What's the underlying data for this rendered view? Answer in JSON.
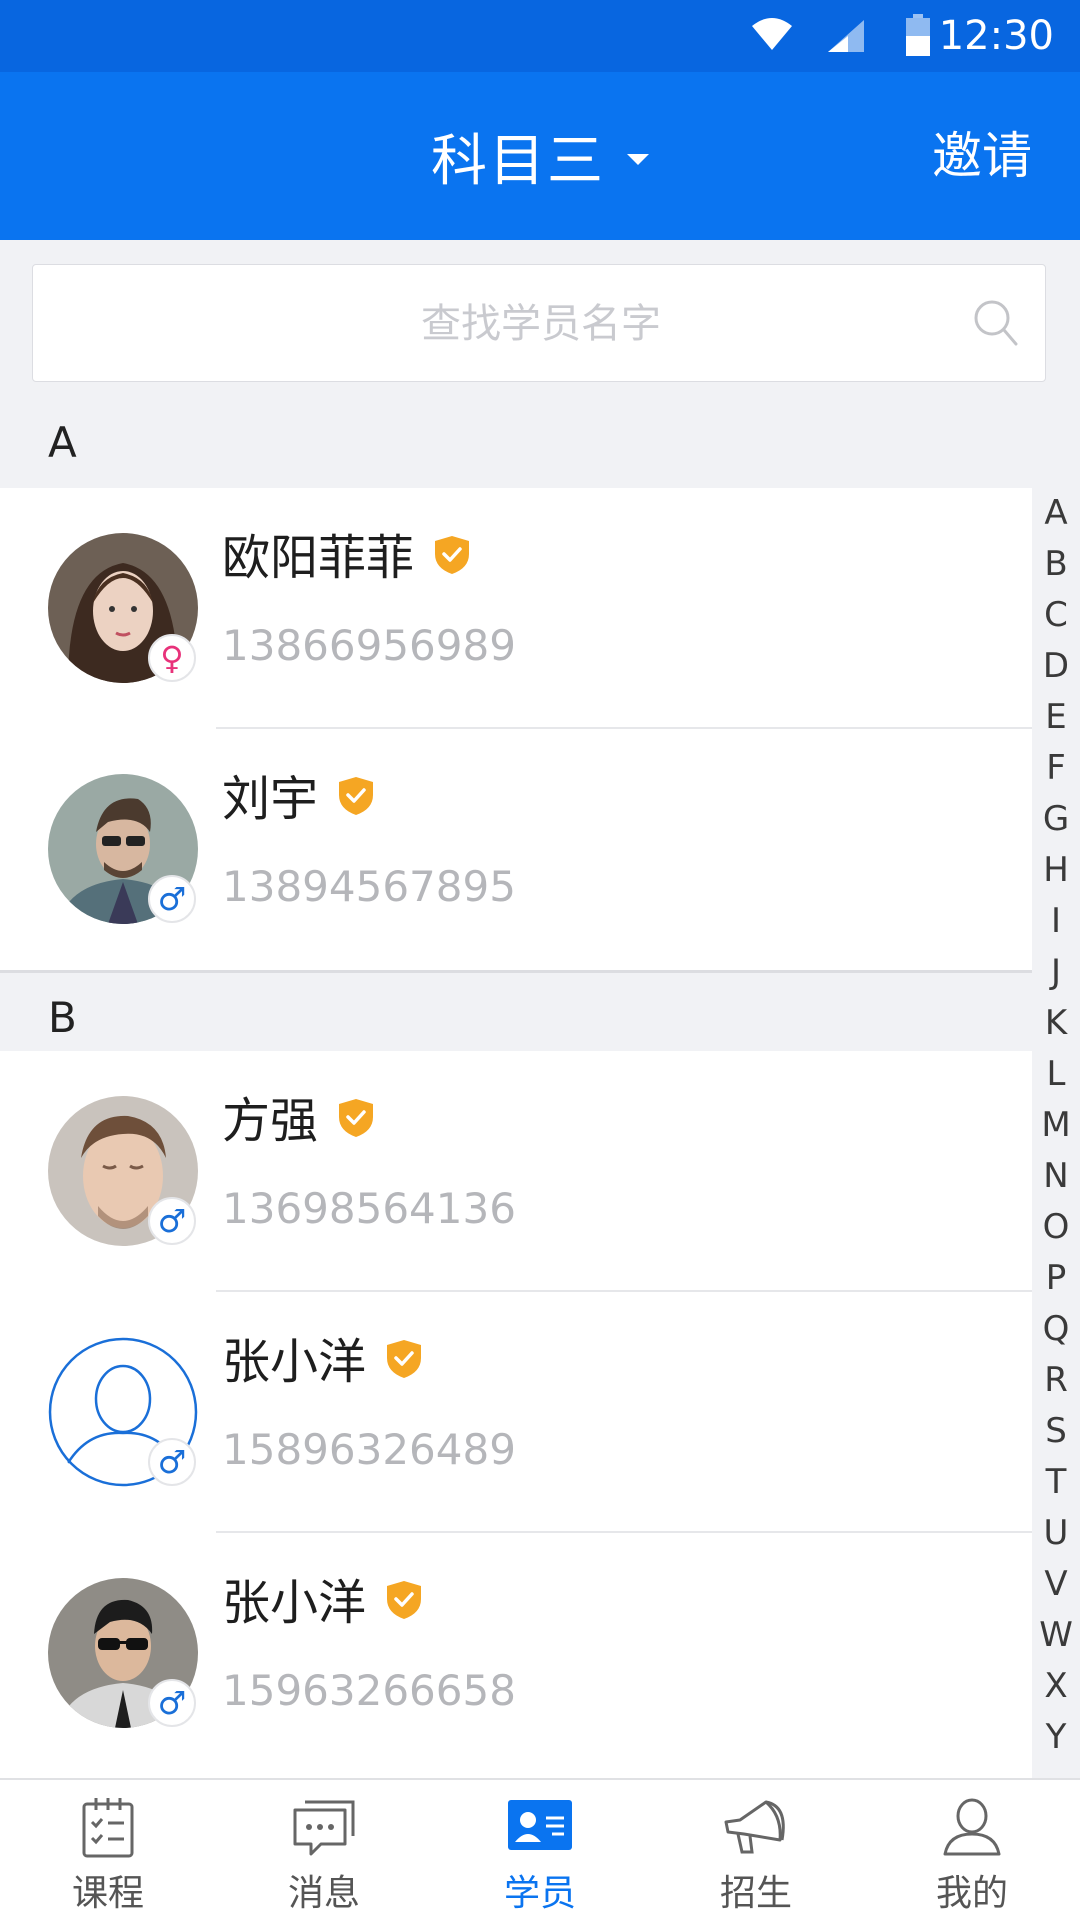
{
  "status_bar": {
    "time": "12:30"
  },
  "header": {
    "title": "科目三",
    "invite_label": "邀请"
  },
  "search": {
    "placeholder": "查找学员名字"
  },
  "sections": [
    {
      "letter": "A",
      "students": [
        {
          "name": "欧阳菲菲",
          "phone": "13866956989",
          "gender": "female",
          "gender_symbol": "♀"
        },
        {
          "name": "刘宇",
          "phone": "13894567895",
          "gender": "male",
          "gender_symbol": "♂"
        }
      ]
    },
    {
      "letter": "B",
      "students": [
        {
          "name": "方强",
          "phone": "13698564136",
          "gender": "male",
          "gender_symbol": "♂"
        },
        {
          "name": "张小洋",
          "phone": "15896326489",
          "gender": "male",
          "gender_symbol": "♂"
        },
        {
          "name": "张小洋",
          "phone": "15963266658",
          "gender": "male",
          "gender_symbol": "♂"
        }
      ]
    }
  ],
  "index_letters": [
    "A",
    "B",
    "C",
    "D",
    "E",
    "F",
    "G",
    "H",
    "I",
    "J",
    "K",
    "L",
    "M",
    "N",
    "O",
    "P",
    "Q",
    "R",
    "S",
    "T",
    "U",
    "V",
    "W",
    "X",
    "Y"
  ],
  "tabs": [
    {
      "label": "课程",
      "icon": "course-icon",
      "active": false
    },
    {
      "label": "消息",
      "icon": "message-icon",
      "active": false
    },
    {
      "label": "学员",
      "icon": "student-card-icon",
      "active": true
    },
    {
      "label": "招生",
      "icon": "megaphone-icon",
      "active": false
    },
    {
      "label": "我的",
      "icon": "profile-icon",
      "active": false
    }
  ],
  "colors": {
    "primary": "#0a74f0",
    "status_bar": "#0866e0",
    "verify_badge": "#f5a623",
    "female": "#e8327a",
    "male": "#1a6fd8"
  }
}
